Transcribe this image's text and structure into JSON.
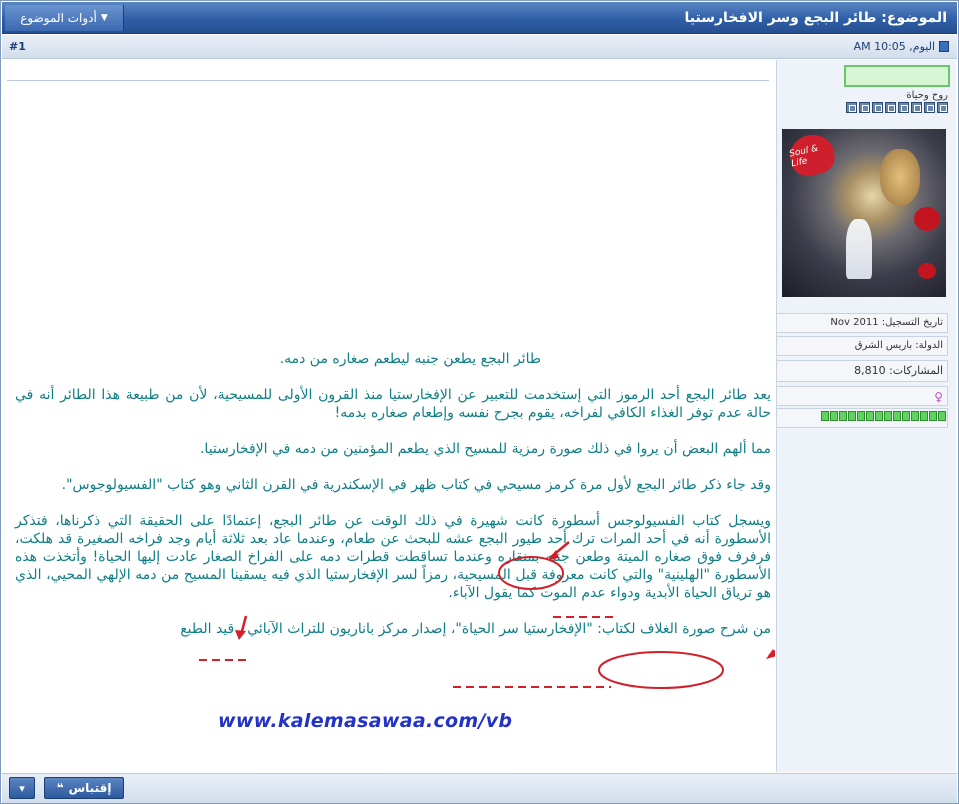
{
  "header": {
    "thread_title": "الموضوع: طائر البجع وسر الافخارستيا",
    "tools_label": "أدوات الموضوع",
    "tools_icon": "chevron-down-icon"
  },
  "post": {
    "number": "#1",
    "date": "اليوم, 10:05 AM"
  },
  "user": {
    "title": "روح وحياة",
    "rank_icons": 8,
    "join_date": "تاريخ التسجيل: Nov 2011",
    "country": "الدولة: باريس الشرق",
    "posts": "المشاركات: 8,810",
    "gender_icon": "♀",
    "reputation_bars": 14,
    "avatar_caption": "Soul & Life",
    "online_status": "online"
  },
  "body": {
    "paragraphs": [
      "طائر البجع يطعن جنبه ليطعم صغاره من دمه.",
      "يعد طائر البجع أحد الرموز التي إستخدمت للتعبير عن الإفخارستيا منذ القرون الأولى للمسيحية، لأن من طبيعة هذا الطائر أنه في حالة عدم توفر الغذاء الكافي لفراخه، يقوم بجرح نفسه وإطعام صغاره بدمه!",
      "مما ألهم البعض أن يروا في ذلك صورة رمزية للمسيح الذي يطعم المؤمنين من دمه في الإفخارستيا.",
      "وقد جاء ذكر طائر البجع لأول مرة كرمز مسيحي في كتاب ظهر في الإسكندرية في القرن الثاني وهو كتاب \"الفسيولوجوس\".",
      "ويسجل كتاب الفسيولوجس أسطورة كانت شهيرة في ذلك الوقت عن طائر البجع، إعتمادًا على الحقيقة التي ذكرناها، فتذكر الأسطورة أنه في أحد المرات ترك أحد طيور البجع عشه للبحث عن طعام، وعندما عاد بعد ثلاثة أيام وجد فراخه الصغيرة قد هلكت، فرفرف فوق صغاره الميتة وطعن جنبه بمنقاره وعندما تساقطت قطرات دمه على الفراخ الصغار عادت إليها الحياة! وأتخذت هذه الأسطورة \"الهلينية\" والتي كانت معروفة قبل المسيحية، رمزاً لسر الإفخارستيا الذي فيه يسقينا المسيح من دمه الإلهي المحيي، الذي هو ترياق الحياة الأبدية ودواء عدم الموت كما يقول الآباء.",
      "من شرح صورة الغلاف لكتاب: \"الإفخارستيا سر الحياة\"، إصدار مركز باناريون للتراث الآبائي ـ قيد الطبع"
    ],
    "watermark": "www.kalemasawaa.com/vb"
  },
  "footer": {
    "quote_label": "إقتباس",
    "multiquote_icon": "plus-icon"
  },
  "colors": {
    "text": "#0f7f86",
    "titlebar": "#2f5fa8",
    "annotation": "#d21f2a",
    "watermark": "#2332c8"
  }
}
